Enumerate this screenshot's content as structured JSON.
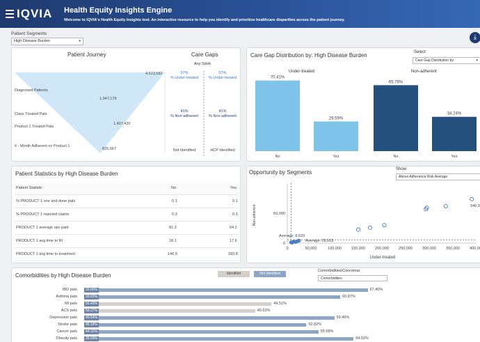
{
  "header": {
    "logo": "IQVIA",
    "title": "Health Equity Insights Engine",
    "subtitle": "Welcome to IQVIA's Health Equity Insights tool. An interactive resource to help you identify and prioritize healthcare disparities across the patient journey."
  },
  "segments": {
    "label": "Patient Segments",
    "selected": "High Disease Burden"
  },
  "journey": {
    "title": "Patient Journey",
    "stages": [
      "Diagnosed Patients",
      "Class Treated Pats",
      "Product 1 Treated Pats",
      "6 - Month Adherent on Product 1"
    ],
    "counts": [
      "4,513,582",
      "1,947,179",
      "1,407,420",
      "825,667"
    ]
  },
  "care_gaps": {
    "title": "Care Gaps",
    "any_sdoh": "Any Sdoh",
    "left": {
      "under_treated": "57%",
      "under_label": "% Under-treated",
      "non_adherent": "41%",
      "non_label": "% Non adherent",
      "footer": "Not Identified"
    },
    "right": {
      "under_treated": "57%",
      "under_label": "% Under-treated",
      "non_adherent": "41%",
      "non_label": "% Non adherent",
      "footer": "HCP Identified"
    }
  },
  "care_gap_dist": {
    "title": "Care Gap Distribution by: High Disease Burden",
    "select_label": "Select:",
    "select_value": "Care Gap Distribution by:",
    "group1": "Under-treated",
    "group2": "Non-adherent",
    "colors": {
      "light": "#7ec3ea",
      "dark": "#24507e"
    }
  },
  "chart_data": [
    {
      "type": "bar",
      "categories": [
        "No",
        "Yes",
        "No",
        "Yes"
      ],
      "values": [
        70.41,
        29.59,
        65.76,
        34.24
      ],
      "labels": [
        "70.41%",
        "29.59%",
        "65.76%",
        "34.24%"
      ],
      "ylim": [
        0,
        75
      ]
    },
    {
      "type": "scatter",
      "title": "Opportunity by Segments",
      "xlabel": "Under-treated",
      "ylabel": "Non-adherent",
      "x_ticks": [
        "0",
        "50,000",
        "100,000",
        "150,000",
        "200,000",
        "250,000",
        "300,000",
        "350,000",
        "400,000"
      ],
      "y_ticks": [
        "0",
        "60,000"
      ],
      "xlim": [
        0,
        400000
      ],
      "ylim": [
        0,
        120000
      ],
      "points": [
        {
          "x": 8000,
          "y": 1500
        },
        {
          "x": 12000,
          "y": 2500
        },
        {
          "x": 15000,
          "y": 3000
        },
        {
          "x": 18000,
          "y": 2000
        },
        {
          "x": 22000,
          "y": 4000
        },
        {
          "x": 10000,
          "y": 1000
        },
        {
          "x": 25000,
          "y": 5000
        },
        {
          "x": 150000,
          "y": 27000
        },
        {
          "x": 175000,
          "y": 31000
        },
        {
          "x": 205000,
          "y": 36000
        },
        {
          "x": 293000,
          "y": 68000
        },
        {
          "x": 295000,
          "y": 71000
        },
        {
          "x": 335000,
          "y": 74000
        },
        {
          "x": 390000,
          "y": 88000
        }
      ],
      "point_label": "540,934",
      "avg_x_label": "Average: 6,633",
      "avg_y_label": "Average: 29,163",
      "show_label": "Show:",
      "show_value": "Above Adherence Risk Average"
    },
    {
      "type": "bar",
      "orientation": "horizontal",
      "title": "Comorbidities by High Disease Burden",
      "categories": [
        "IBD pats",
        "Asthma pats",
        "MI pats",
        "ACS pats",
        "Depression pats",
        "Stroke pats",
        "Cancer pats",
        "Obesity pats"
      ],
      "values": [
        67.4,
        60.87,
        44.51,
        40.63,
        59.46,
        52.82,
        55.68,
        64.02
      ],
      "labels": [
        "67.40%",
        "60.87%",
        "44.51%",
        "40.63%",
        "59.46%",
        "52.82%",
        "55.68%",
        "64.02%"
      ],
      "badges": [
        "32.60%",
        "39.83%",
        "55.49%",
        "59.37%",
        "40.54%",
        "46.18%",
        "44.32%",
        "35.99%"
      ],
      "xlim": [
        0,
        100
      ]
    }
  ],
  "stats": {
    "title": "Patient Statistics by High Disease Burden",
    "head": [
      "Patient Statistic",
      "No",
      "Yes"
    ],
    "rows": [
      [
        "% PRODUCT 1 one and done pats",
        "0.1",
        "0.1"
      ],
      [
        "% PRODUCT 1 rejected claims",
        "0.3",
        "0.3"
      ],
      [
        "PRODUCT 1 average opc paid",
        "81.3",
        "64.2"
      ],
      [
        "PRODUCT 1 avg time to fill",
        "18.1",
        "17.6"
      ],
      [
        "PRODUCT 1 avg time to treatment",
        "146.9",
        "183.8"
      ]
    ]
  },
  "comorb": {
    "chip1": "Identified",
    "chip2": "Not Identified",
    "select_label": "Comorbidities/Concomar",
    "select_value": "Comorbidities"
  }
}
